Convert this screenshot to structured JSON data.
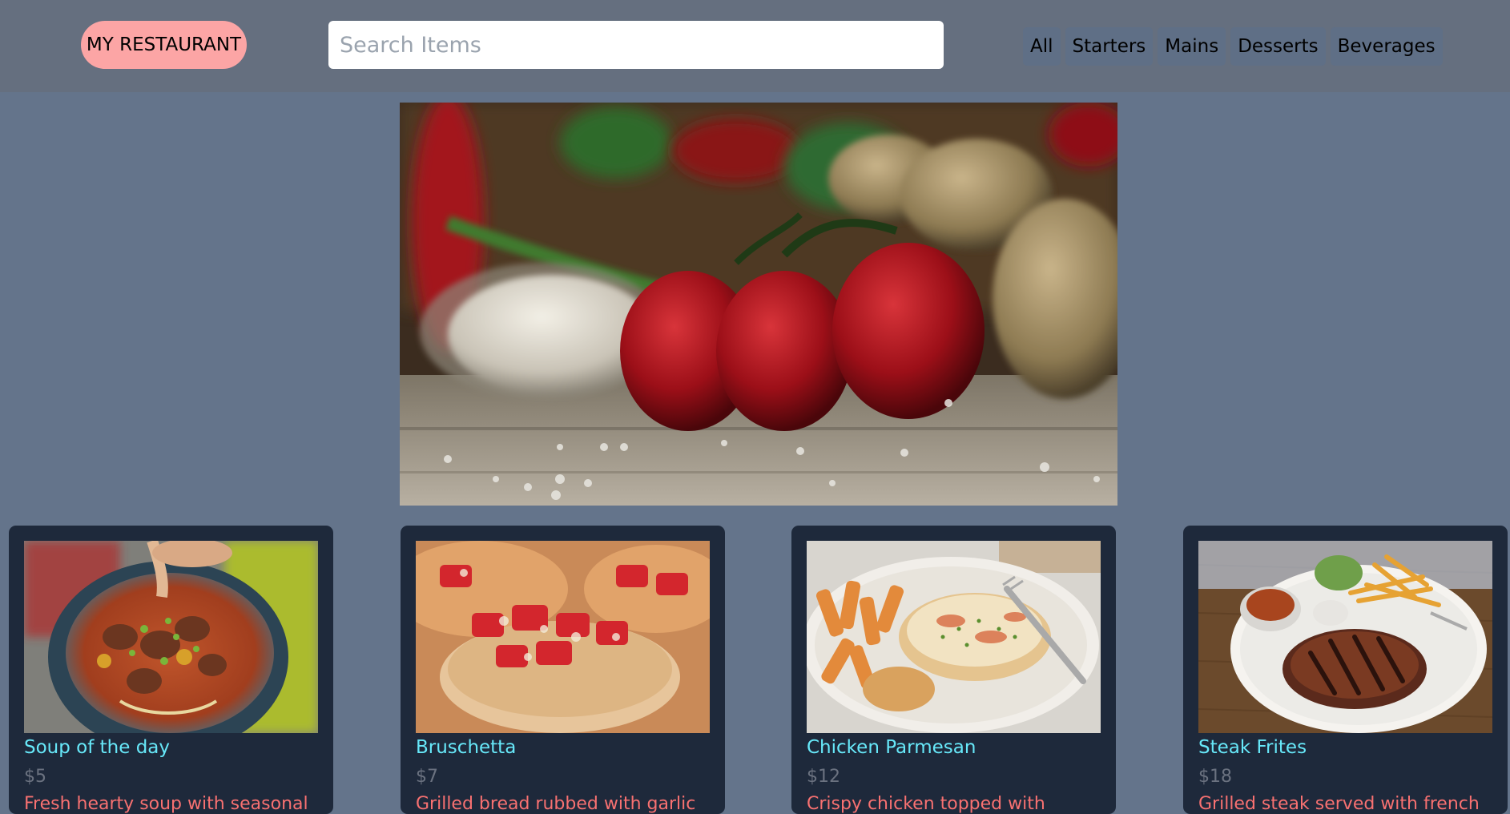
{
  "header": {
    "brand": "MY RESTAURANT",
    "search_placeholder": "Search Items",
    "search_value": ""
  },
  "nav": {
    "tabs": [
      "All",
      "Starters",
      "Mains",
      "Desserts",
      "Beverages"
    ]
  },
  "hero": {
    "image_subject": "vegetables (tomatoes, garlic, potatoes) on a wooden table"
  },
  "menu": {
    "items": [
      {
        "name": "Soup of the day",
        "price": "$5",
        "desc": "Fresh hearty soup with seasonal",
        "image_subject": "beef noodle soup"
      },
      {
        "name": "Bruschetta",
        "price": "$7",
        "desc": "Grilled bread rubbed with garlic",
        "image_subject": "bruschetta"
      },
      {
        "name": "Chicken Parmesan",
        "price": "$12",
        "desc": "Crispy chicken topped with",
        "image_subject": "chicken parmesan with pasta"
      },
      {
        "name": "Steak Frites",
        "price": "$18",
        "desc": "Grilled steak served with french",
        "image_subject": "steak with fries"
      }
    ]
  },
  "colors": {
    "page_bg": "#64748b",
    "header_bg": "#656f7f",
    "brand_bg": "#fca5a5",
    "card_bg": "#1e293b",
    "item_name": "#67e8f9",
    "item_price": "#6b7280",
    "item_desc": "#f87171"
  }
}
